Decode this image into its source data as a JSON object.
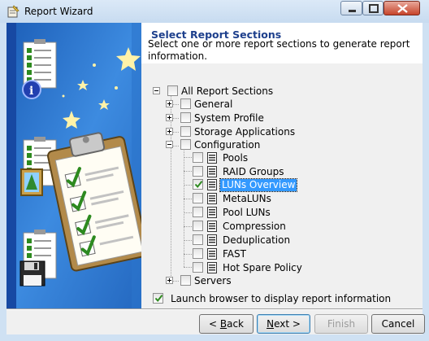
{
  "window": {
    "title": "Report Wizard"
  },
  "header": {
    "title": "Select Report Sections",
    "description": "Select one or more report sections to generate report information."
  },
  "tree": {
    "root": "All Report Sections",
    "general": "General",
    "system_profile": "System Profile",
    "storage_applications": "Storage Applications",
    "configuration": "Configuration",
    "pools": "Pools",
    "raid_groups": "RAID Groups",
    "luns_overview": "LUNs Overview",
    "metaluns": "MetaLUNs",
    "pool_luns": "Pool LUNs",
    "compression": "Compression",
    "deduplication": "Deduplication",
    "fast": "FAST",
    "hot_spare_policy": "Hot Spare Policy",
    "servers": "Servers",
    "checked_item": "LUNs Overview"
  },
  "launch_browser": {
    "label": "Launch browser to display report information",
    "checked": true
  },
  "buttons": {
    "back_prefix": "< ",
    "back_mnemonic": "B",
    "back_rest": "ack",
    "next_mnemonic": "N",
    "next_rest": "ext >",
    "finish": "Finish",
    "cancel": "Cancel"
  },
  "colors": {
    "accent_blue": "#1d3f8c",
    "selection": "#3399ff",
    "check_green": "#2d8a1f"
  }
}
